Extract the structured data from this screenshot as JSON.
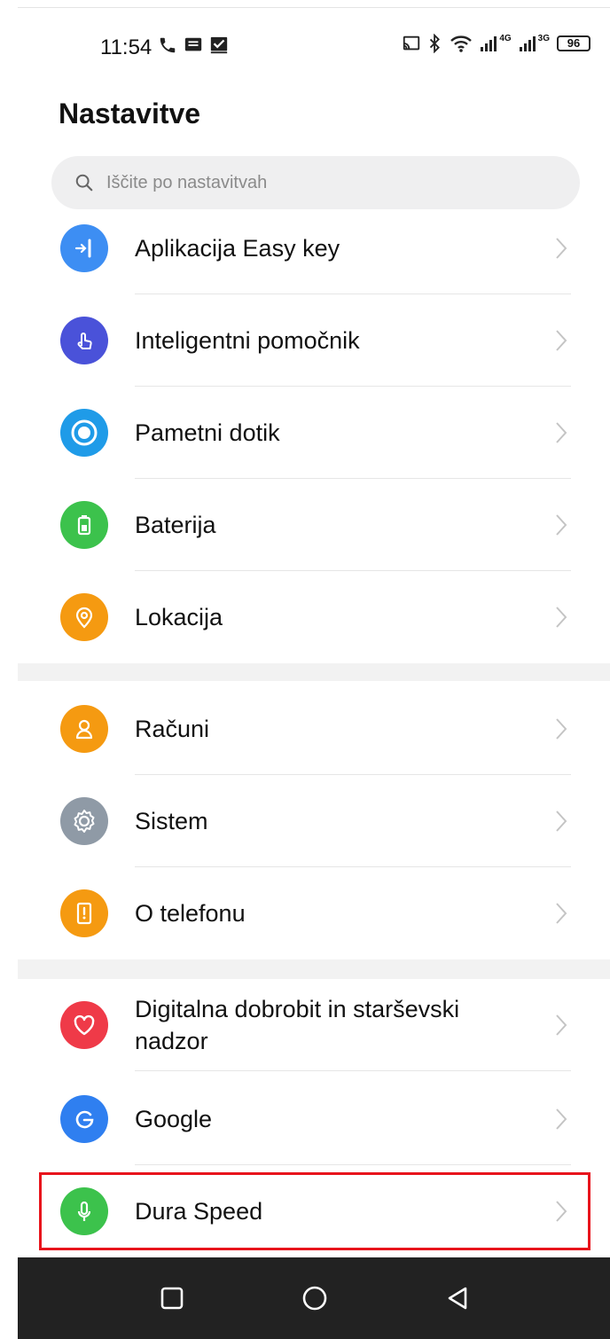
{
  "status_bar": {
    "time": "11:54",
    "icons_left": [
      "phone-icon",
      "message-icon",
      "checkbox-icon"
    ],
    "icons_right": [
      "cast-icon",
      "bluetooth-icon",
      "wifi-icon",
      "signal-4g-icon",
      "signal-3g-icon"
    ],
    "network_4g": "4G",
    "network_3g": "3G",
    "battery": "96"
  },
  "header": {
    "title": "Nastavitve"
  },
  "search": {
    "placeholder": "Iščite po nastavitvah"
  },
  "groups": [
    {
      "items": [
        {
          "label": "Aplikacija Easy key",
          "icon": "easy-key-icon",
          "color": "#3d8ef3"
        },
        {
          "label": "Inteligentni pomočnik",
          "icon": "hand-pointer-icon",
          "color": "#4a52d9"
        },
        {
          "label": "Pametni dotik",
          "icon": "smart-touch-icon",
          "color": "#1f9be8"
        },
        {
          "label": "Baterija",
          "icon": "battery-icon",
          "color": "#3cc24c"
        },
        {
          "label": "Lokacija",
          "icon": "location-pin-icon",
          "color": "#f59a11"
        }
      ]
    },
    {
      "items": [
        {
          "label": "Računi",
          "icon": "person-icon",
          "color": "#f59a11"
        },
        {
          "label": "Sistem",
          "icon": "gear-icon",
          "color": "#8f9aa6"
        },
        {
          "label": "O telefonu",
          "icon": "phone-info-icon",
          "color": "#f59a11"
        }
      ]
    },
    {
      "items": [
        {
          "label": "Digitalna dobrobit in starševski nadzor",
          "icon": "heart-icon",
          "color": "#ef3a48"
        },
        {
          "label": "Google",
          "icon": "google-icon",
          "color": "#2f7ff0"
        },
        {
          "label": "Dura Speed",
          "icon": "dura-speed-icon",
          "color": "#3cc24c"
        }
      ]
    }
  ],
  "highlighted_item": "Dura Speed",
  "highlight_color": "#e8141c",
  "nav_bar": {
    "buttons": [
      "recents-square-icon",
      "home-circle-icon",
      "back-triangle-icon"
    ]
  }
}
